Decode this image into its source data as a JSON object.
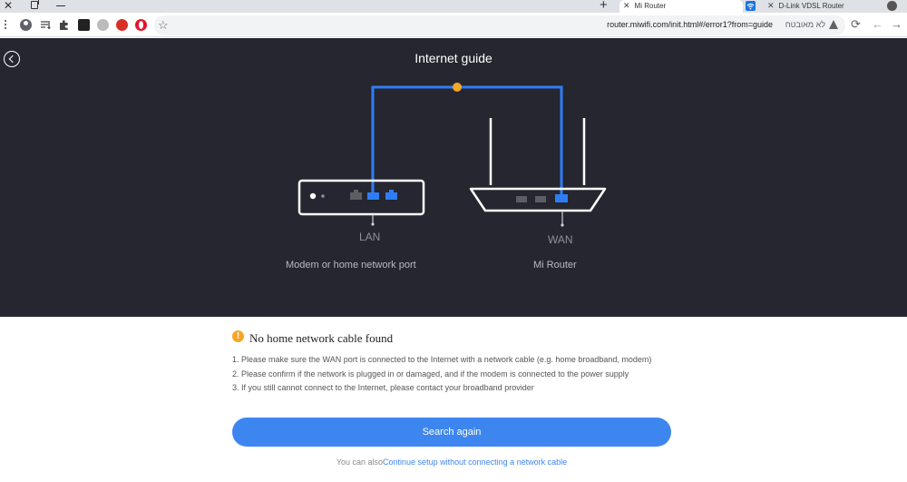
{
  "browser": {
    "tabs": [
      {
        "title": "Mi Router",
        "active": true
      },
      {
        "title": "D-Link VDSL Router",
        "active": false
      }
    ],
    "url": "router.miwifi.com/init.html#/error1?from=guide",
    "security_label": "לא מאובטח",
    "icons": [
      "close-icon",
      "restore-icon",
      "minimize-icon",
      "plus-icon",
      "menu-icon",
      "profile-icon",
      "reading-list-icon",
      "extensions-icon",
      "star-icon",
      "reload-icon",
      "back-icon",
      "forward-icon",
      "warning-icon"
    ]
  },
  "hero": {
    "title": "Internet guide",
    "lan_label": "LAN",
    "wan_label": "WAN",
    "modem_label": "Modem or home network port",
    "router_label": "Mi Router",
    "colors": {
      "background": "#25262f",
      "cable": "#2f7df6",
      "device": "#ffffff",
      "warning_dot": "#f5a623"
    }
  },
  "error": {
    "badge": "!",
    "title": "No home network cable found",
    "steps": [
      "1. Please make sure the WAN port is connected to the Internet with a network cable (e.g. home broadband, modem)",
      "2. Please confirm if the network is plugged in or damaged, and if the modem is connected to the power supply",
      "3. If you still cannot connect to the Internet, please contact your broadband provider"
    ],
    "button_label": "Search again",
    "alt_prefix": "You can also",
    "alt_link": "Continue setup without connecting a network cable",
    "colors": {
      "accent": "#3d86f0",
      "warning": "#f5a623"
    }
  }
}
